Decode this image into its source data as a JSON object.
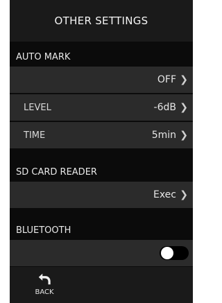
{
  "header": {
    "title": "OTHER SETTINGS"
  },
  "auto_mark": {
    "section_label": "AUTO MARK",
    "mode_value": "OFF",
    "level_label": "LEVEL",
    "level_value": "-6dB",
    "time_label": "TIME",
    "time_value": "5min"
  },
  "sd_card_reader": {
    "section_label": "SD CARD READER",
    "action_value": "Exec"
  },
  "bluetooth": {
    "section_label": "BLUETOOTH",
    "toggle_state": "off"
  },
  "footer": {
    "back_label": "BACK"
  },
  "icons": {
    "chevron": "chevron-right-icon",
    "back": "back-arrow-icon"
  },
  "colors": {
    "background": "#0b0b0b",
    "row": "#2b2b2b",
    "header": "#1a1a1a",
    "text": "#e6e6e6"
  }
}
